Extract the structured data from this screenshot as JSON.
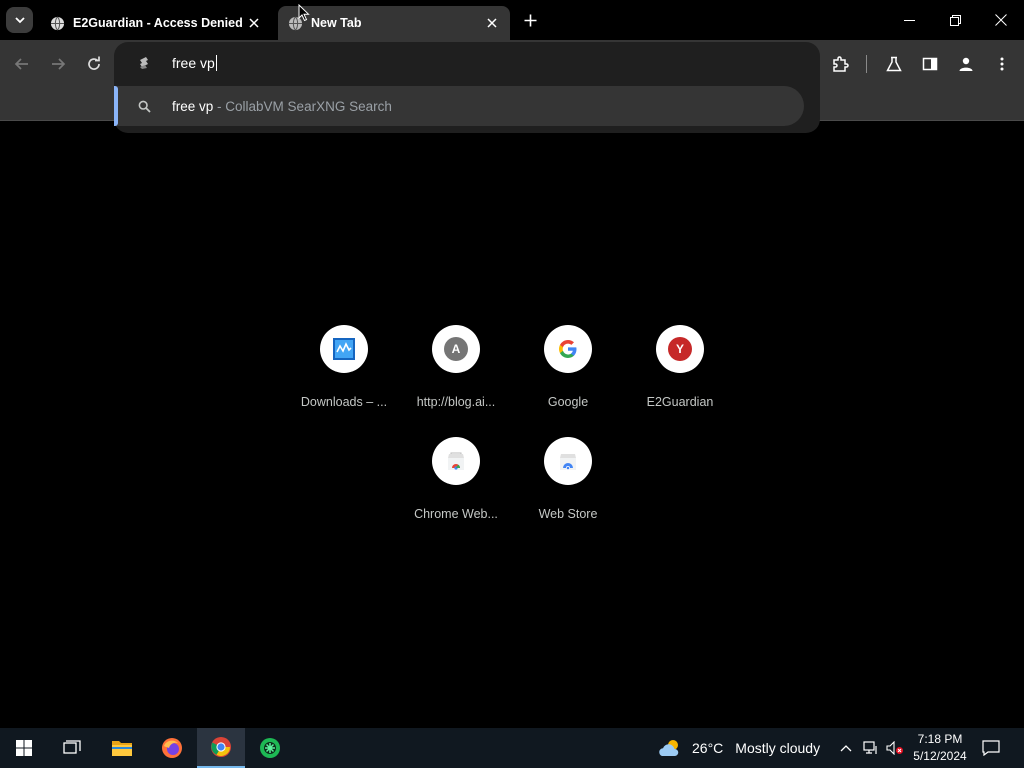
{
  "tabs": [
    {
      "title": "E2Guardian - Access Denied",
      "state": "inactive"
    },
    {
      "title": "New Tab",
      "state": "active"
    }
  ],
  "omnibox": {
    "input_value": "free vp",
    "suggestion_query": "free vp",
    "suggestion_separator": " - ",
    "suggestion_desc": "CollabVM SearXNG Search"
  },
  "shortcuts": [
    {
      "label": "Downloads – ...",
      "icon": "vm-downloads-icon"
    },
    {
      "label": "http://blog.ai...",
      "icon": "letter-a-icon",
      "letter": "A"
    },
    {
      "label": "Google",
      "icon": "google-icon"
    },
    {
      "label": "E2Guardian",
      "icon": "letter-y-icon",
      "letter": "Y"
    },
    {
      "label": "Chrome Web...",
      "icon": "chrome-web-store-icon"
    },
    {
      "label": "Web Store",
      "icon": "web-store-icon"
    }
  ],
  "taskbar": {
    "weather_temp": "26°C",
    "weather_desc": "Mostly cloudy",
    "time": "7:18 PM",
    "date": "5/12/2024"
  },
  "colors": {
    "accent": "#8ab4f8",
    "toolbar": "#353535",
    "popup": "#1f1f1f",
    "taskbar": "#101820"
  }
}
